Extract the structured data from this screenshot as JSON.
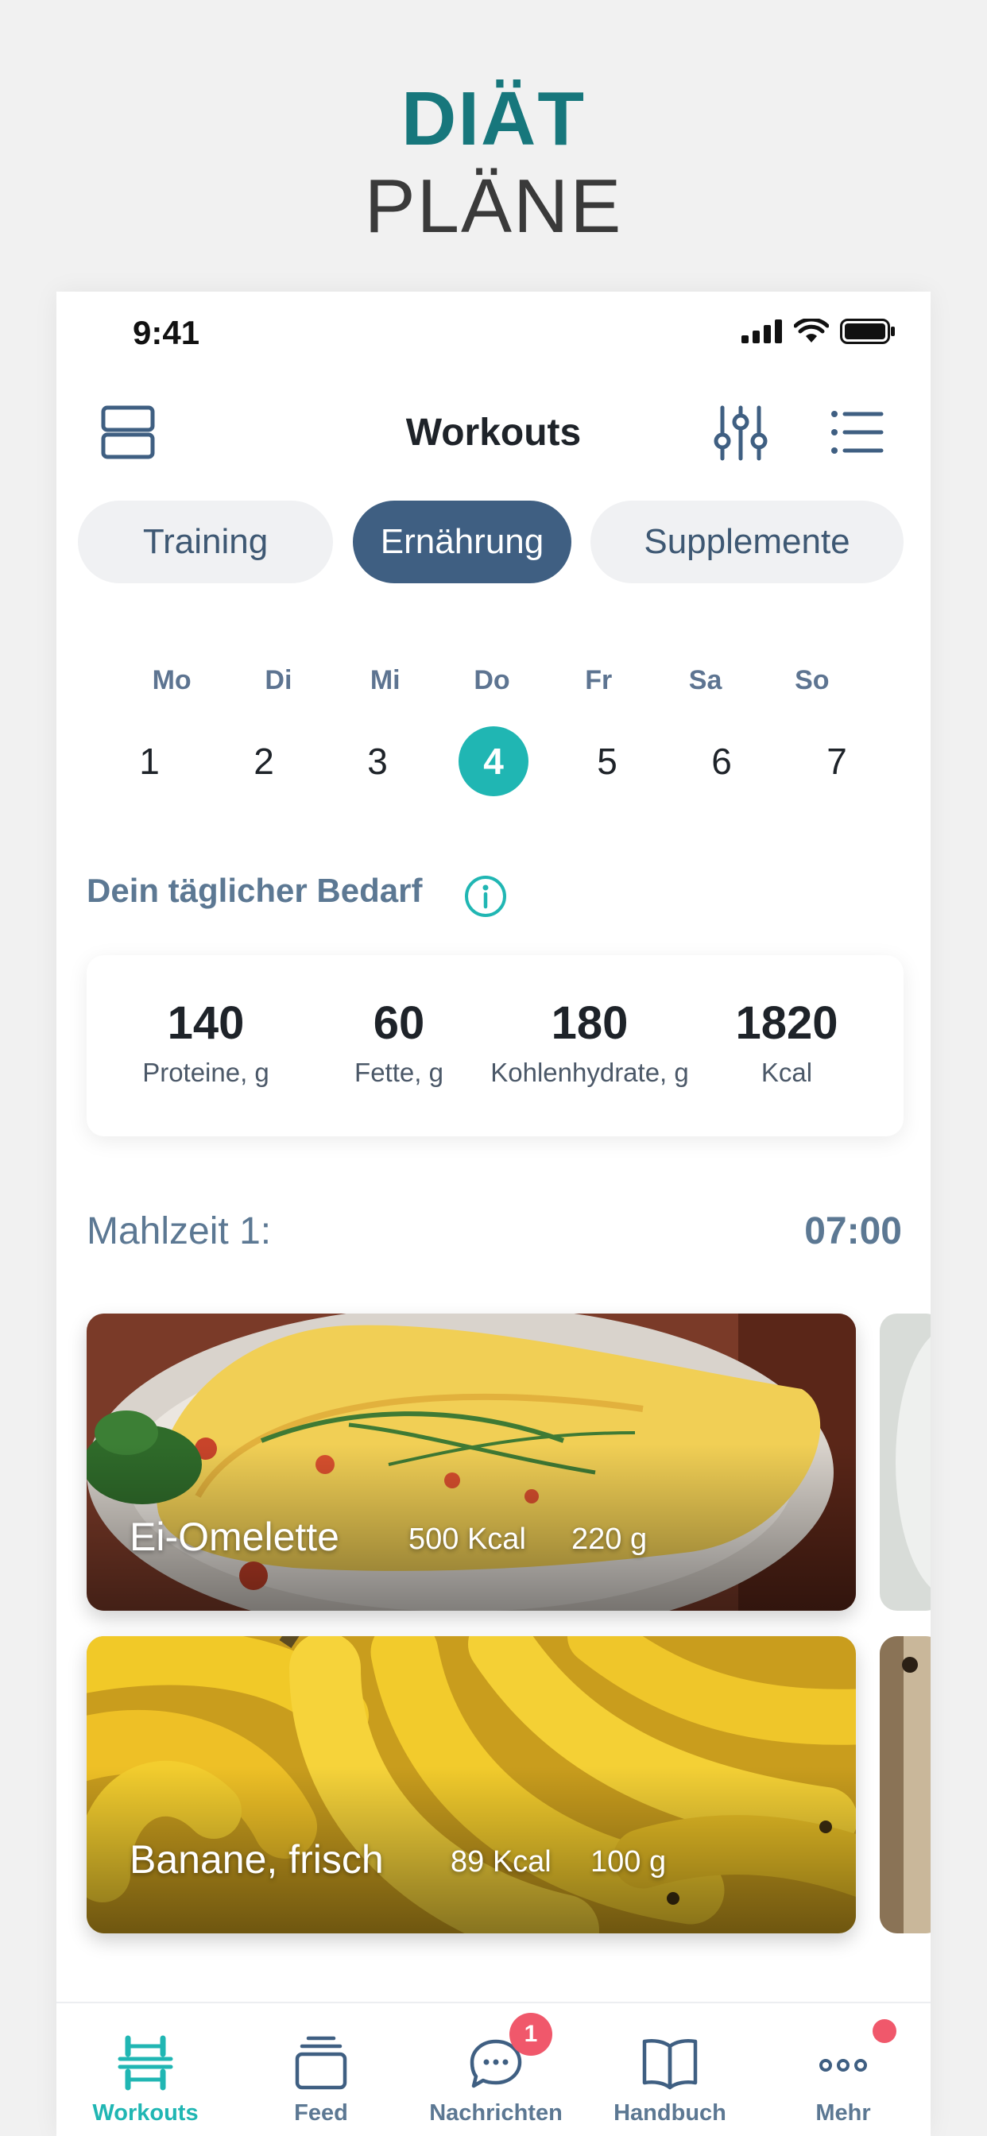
{
  "hero": {
    "line1": "DIÄT",
    "line2": "PLÄNE"
  },
  "status_bar": {
    "time": "9:41"
  },
  "nav": {
    "title": "Workouts"
  },
  "segments": [
    {
      "label": "Training",
      "active": false
    },
    {
      "label": "Ernährung",
      "active": true
    },
    {
      "label": "Supplemente",
      "active": false
    }
  ],
  "week": {
    "days": [
      "Mo",
      "Di",
      "Mi",
      "Do",
      "Fr",
      "Sa",
      "So"
    ],
    "dates": [
      "1",
      "2",
      "3",
      "4",
      "5",
      "6",
      "7"
    ],
    "selected": "4"
  },
  "daily_requirement": {
    "title": "Dein täglicher Bedarf",
    "macros": [
      {
        "value": "140",
        "label": "Proteine, g"
      },
      {
        "value": "60",
        "label": "Fette, g"
      },
      {
        "value": "180",
        "label": "Kohlenhydrate, g"
      },
      {
        "value": "1820",
        "label": "Kcal"
      }
    ]
  },
  "meal": {
    "title": "Mahlzeit 1:",
    "time": "07:00",
    "items": [
      {
        "name": "Ei-Omelette",
        "kcal": "500 Kcal",
        "weight": "220 g"
      },
      {
        "name": "Banane, frisch",
        "kcal": "89 Kcal",
        "weight": "100 g"
      }
    ]
  },
  "tabbar": {
    "items": [
      {
        "label": "Workouts",
        "icon": "dumbbell-icon",
        "active": true
      },
      {
        "label": "Feed",
        "icon": "stack-icon",
        "active": false
      },
      {
        "label": "Nachrichten",
        "icon": "chat-icon",
        "badge": "1",
        "active": false
      },
      {
        "label": "Handbuch",
        "icon": "book-icon",
        "active": false
      },
      {
        "label": "Mehr",
        "icon": "more-icon",
        "active": false
      }
    ]
  },
  "colors": {
    "accent": "#20b6b3",
    "primary": "#3f5f82",
    "muted_text": "#5c7893",
    "hero_accent": "#17777c",
    "badge": "#f0586b"
  }
}
